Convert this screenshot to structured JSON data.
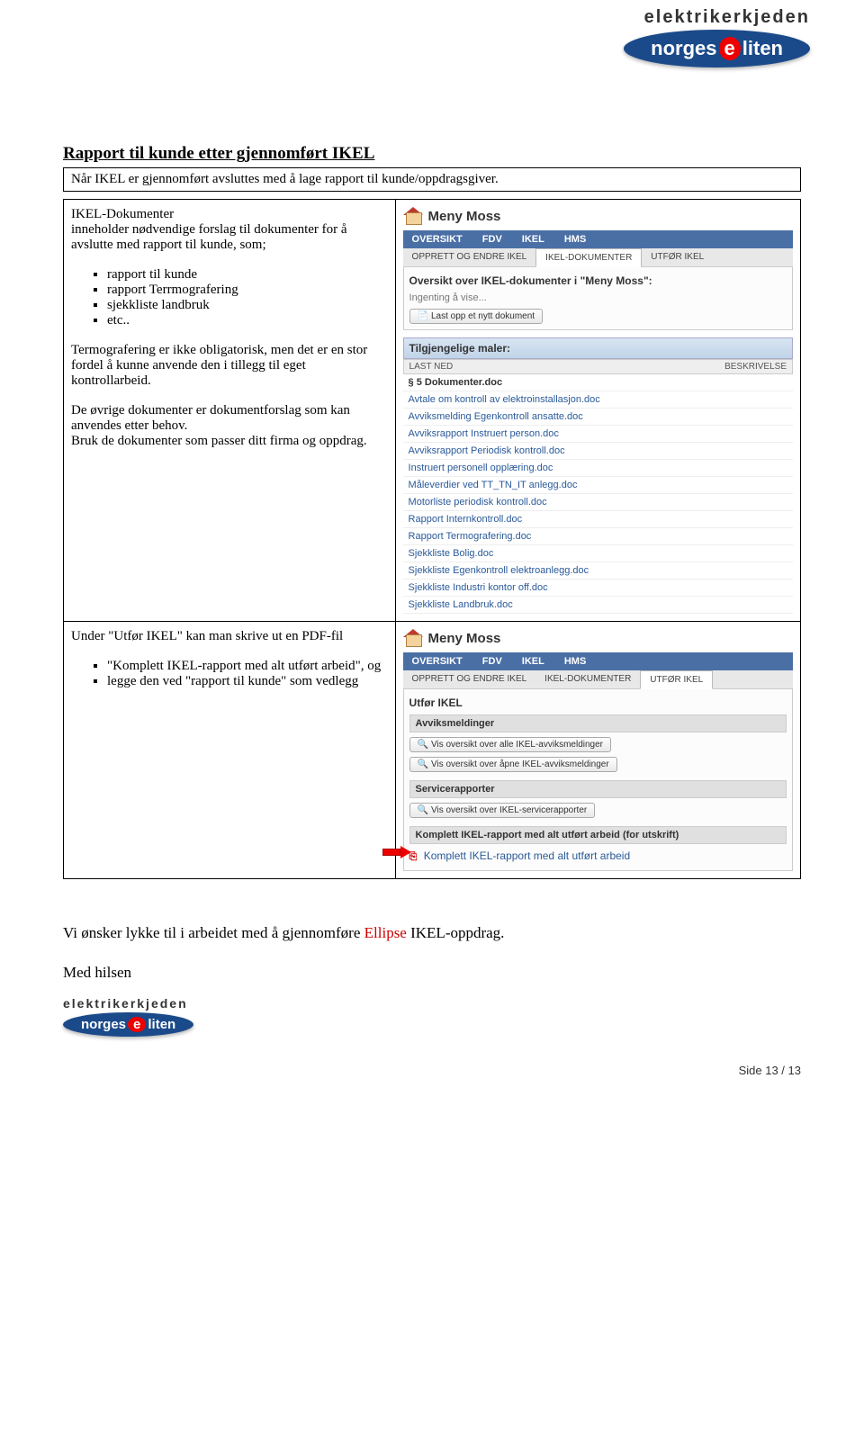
{
  "header": {
    "brand_top": "elektrikerkjeden",
    "brand_main": "norgeseliten"
  },
  "title": "Rapport til kunde etter gjennomført IKEL",
  "intro": "Når IKEL er gjennomført avsluttes med å lage rapport til kunde/oppdragsgiver.",
  "sec1": {
    "head": "IKEL-Dokumenter",
    "p1": "inneholder nødvendige forslag til dokumenter for å avslutte med rapport til kunde, som;",
    "bullets": [
      "rapport til kunde",
      "rapport Terrmografering",
      "sjekkliste landbruk",
      "etc.."
    ],
    "p2": "Termografering er ikke obligatorisk, men det er en stor fordel å kunne anvende den i tillegg til eget kontrollarbeid.",
    "p3": "De øvrige dokumenter er dokumentforslag som kan anvendes etter behov.",
    "p4": "Bruk de dokumenter som passer ditt firma og oppdrag."
  },
  "sec2": {
    "p1": "Under \"Utfør IKEL\" kan man skrive ut en PDF-fil",
    "bullets": [
      "\"Komplett IKEL-rapport med alt utført arbeid\", og",
      "legge den ved \"rapport til kunde\" som vedlegg"
    ]
  },
  "shot": {
    "meny": "Meny Moss",
    "tabs": [
      "OVERSIKT",
      "FDV",
      "IKEL",
      "HMS"
    ],
    "subtabs": [
      "OPPRETT OG ENDRE IKEL",
      "IKEL-DOKUMENTER",
      "UTFØR IKEL"
    ]
  },
  "shot1": {
    "title": "Oversikt over IKEL-dokumenter i \"Meny Moss\":",
    "empty": "Ingenting å vise...",
    "upload": "Last opp et nytt dokument",
    "maler": "Tilgjengelige maler:",
    "col1": "LAST NED",
    "col2": "BESKRIVELSE",
    "rows": [
      "§ 5 Dokumenter.doc",
      "Avtale om kontroll av elektroinstallasjon.doc",
      "Avviksmelding Egenkontroll ansatte.doc",
      "Avviksrapport Instruert person.doc",
      "Avviksrapport Periodisk kontroll.doc",
      "Instruert personell opplæring.doc",
      "Måleverdier ved TT_TN_IT anlegg.doc",
      "Motorliste periodisk kontroll.doc",
      "Rapport Internkontroll.doc",
      "Rapport Termografering.doc",
      "Sjekkliste Bolig.doc",
      "Sjekkliste Egenkontroll elektroanlegg.doc",
      "Sjekkliste Industri kontor off.doc",
      "Sjekkliste Landbruk.doc"
    ]
  },
  "shot2": {
    "title": "Utfør IKEL",
    "g1": "Avviksmeldinger",
    "b1": "Vis oversikt over alle IKEL-avviksmeldinger",
    "b2": "Vis oversikt over åpne IKEL-avviksmeldinger",
    "g2": "Servicerapporter",
    "b3": "Vis oversikt over IKEL-servicerapporter",
    "g3": "Komplett IKEL-rapport med alt utført arbeid (for utskrift)",
    "link": "Komplett IKEL-rapport med alt utført arbeid"
  },
  "closing": {
    "pre": "Vi ønsker lykke til i arbeidet med å gjennomføre ",
    "red": "Ellipse",
    "post": " IKEL-oppdrag."
  },
  "signoff": "Med hilsen",
  "footer": "Side 13 / 13"
}
